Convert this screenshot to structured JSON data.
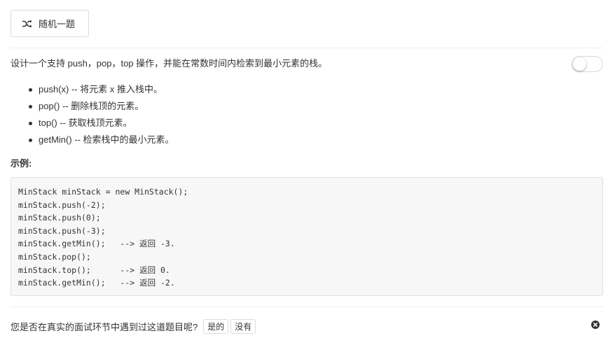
{
  "toolbar": {
    "random_label": "随机一题",
    "random_icon": "shuffle-icon"
  },
  "problem": {
    "description": "设计一个支持 push，pop，top 操作，并能在常数时间内检索到最小元素的栈。",
    "operations": [
      "push(x) -- 将元素 x 推入栈中。",
      "pop() -- 删除栈顶的元素。",
      "top() -- 获取栈顶元素。",
      "getMin() -- 检索栈中的最小元素。"
    ],
    "example_title": "示例:",
    "example_code": [
      "MinStack minStack = new MinStack();",
      "minStack.push(-2);",
      "minStack.push(0);",
      "minStack.push(-3);",
      "minStack.getMin();   --> 返回 -3.",
      "minStack.pop();",
      "minStack.top();      --> 返回 0.",
      "minStack.getMin();   --> 返回 -2."
    ]
  },
  "toggle": {
    "on": false
  },
  "feedback": {
    "question": "您是否在真实的面试环节中遇到过这道题目呢?",
    "yes_label": "是的",
    "no_label": "没有",
    "close_icon": "close-circle-icon"
  },
  "colors": {
    "text": "#333333",
    "border": "#dcdcdc",
    "code_bg": "#f7f7f7"
  }
}
